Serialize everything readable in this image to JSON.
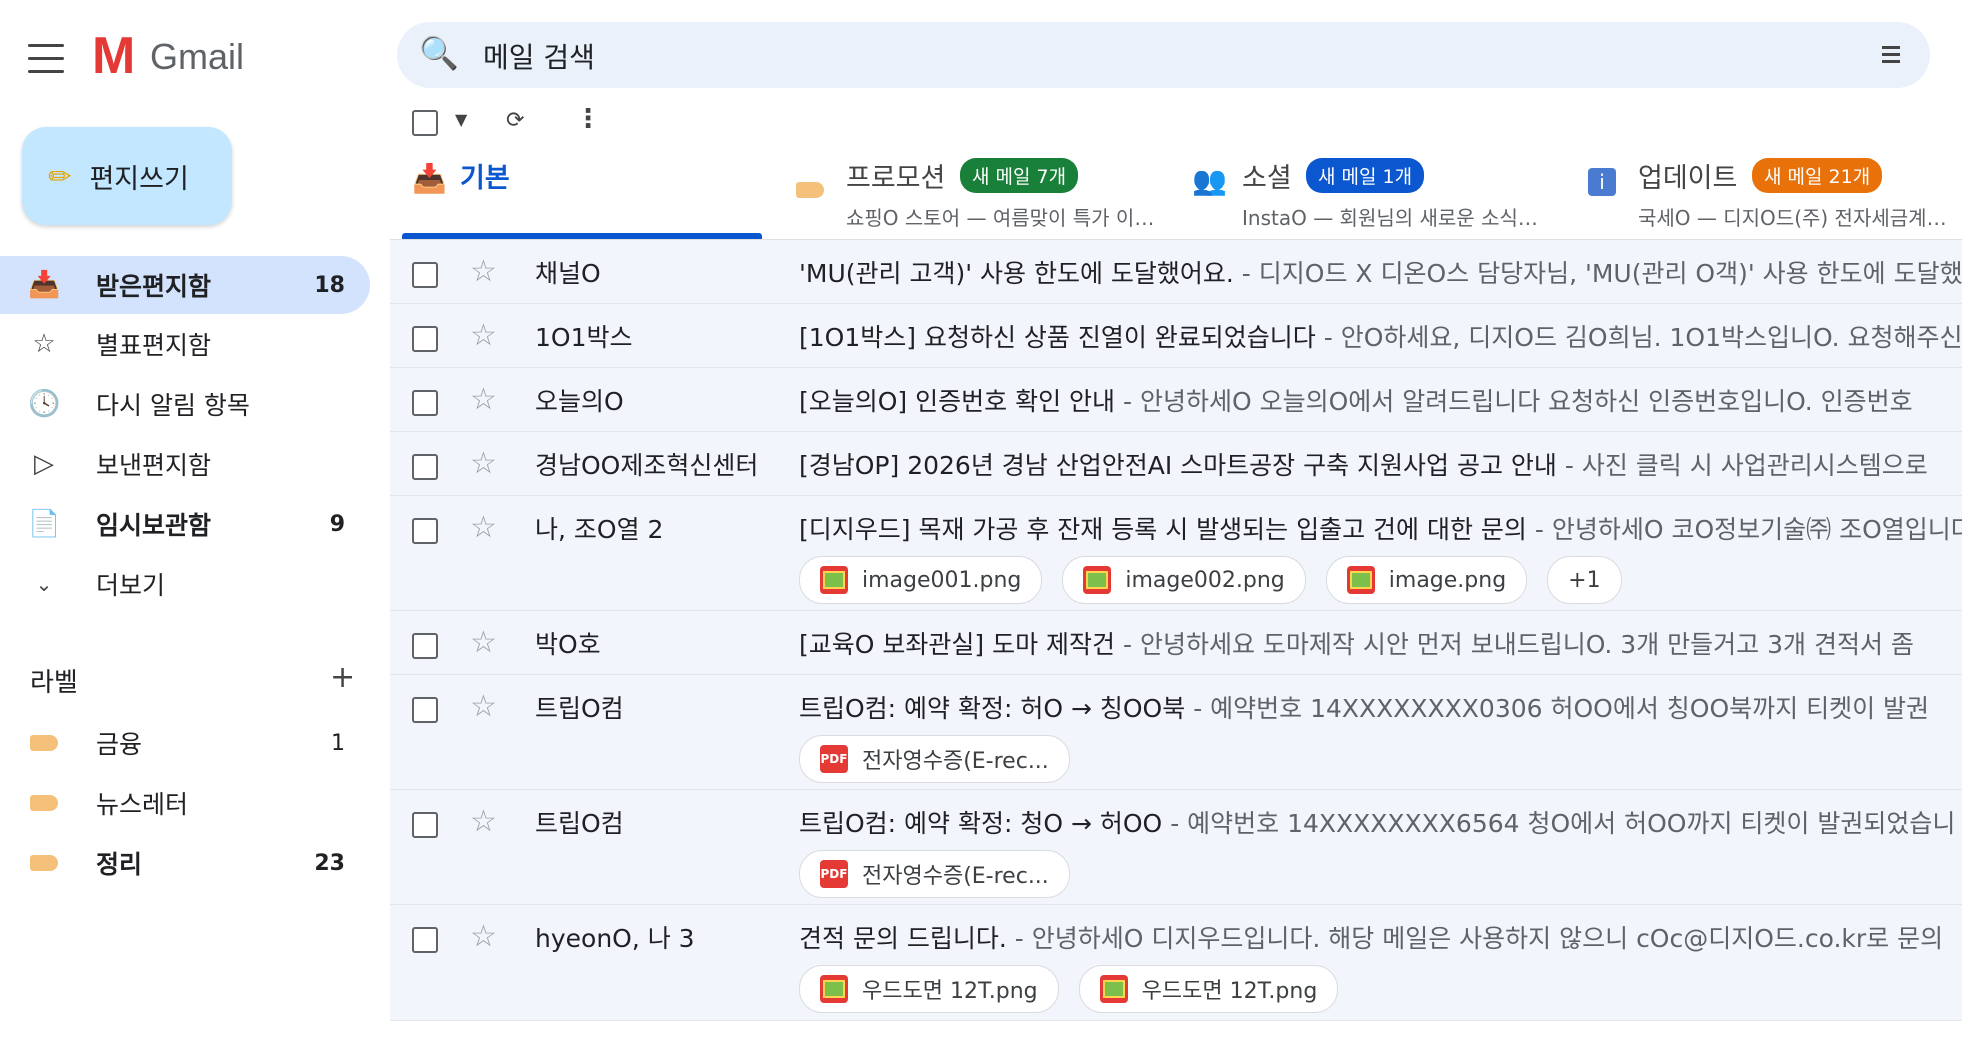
{
  "app": {
    "logo_letter": "M",
    "logo_text": "Gmail"
  },
  "compose": {
    "label": "편지쓰기"
  },
  "sidebar": {
    "items": [
      {
        "label": "받은편지함",
        "count": "18",
        "icon": "inbox-icon"
      },
      {
        "label": "별표편지함",
        "count": "",
        "icon": "star-icon"
      },
      {
        "label": "다시 알림 항목",
        "count": "",
        "icon": "clock-icon"
      },
      {
        "label": "보낸편지함",
        "count": "",
        "icon": "send-icon"
      },
      {
        "label": "임시보관함",
        "count": "9",
        "icon": "draft-icon"
      },
      {
        "label": "더보기",
        "count": "",
        "icon": "chevron-down-icon"
      }
    ],
    "labels_title": "라벨",
    "labels": [
      {
        "label": "금융",
        "count": "1"
      },
      {
        "label": "뉴스레터",
        "count": ""
      },
      {
        "label": "정리",
        "count": "23"
      }
    ]
  },
  "search": {
    "placeholder": "메일 검색"
  },
  "tabs": [
    {
      "name": "기본",
      "badge": "",
      "sub": ""
    },
    {
      "name": "프로모션",
      "badge": "새 메일 7개",
      "badge_color": "#188038",
      "sub": "쇼핑O 스토어 — 여름맞이 특가 이벤트"
    },
    {
      "name": "소셜",
      "badge": "새 메일 1개",
      "badge_color": "#0b57d0",
      "sub": "InstaO — 회원님의 새로운 소식이 있습니다"
    },
    {
      "name": "업데이트",
      "badge": "새 메일 21개",
      "badge_color": "#e8710a",
      "sub": "국세O — 디지O드(주) 전자세금계산서"
    }
  ],
  "emails": [
    {
      "sender": "채널O",
      "subject": "'MU(관리 고객)' 사용 한도에 도달했어요.",
      "snippet": " - 디지O드 X 디온O스 담당자님, 'MU(관리 O객)' 사용 한도에 도달했어요",
      "attachments": []
    },
    {
      "sender": "1O1박스",
      "subject": "[1O1박스] 요청하신 상품 진열이 완료되었습니다",
      "snippet": " - 안O하세요, 디지O드 김O희님. 1O1박스입니O. 요청해주신",
      "attachments": []
    },
    {
      "sender": "오늘의O",
      "subject": "[오늘의O] 인증번호 확인 안내",
      "snippet": " - 안녕하세O 오늘의O에서 알려드립니다 요청하신 인증번호입니O. 인증번호",
      "attachments": []
    },
    {
      "sender": "경남OO제조혁신센터",
      "subject": "[경남OP] 2026년 경남 산업안전AI 스마트공장 구축 지원사업 공고 안내",
      "snippet": " - 사진 클릭 시 사업관리시스템으로",
      "attachments": []
    },
    {
      "sender": "나, 조O열 2",
      "subject": "[디지우드] 목재 가공 후 잔재 등록 시 발생되는 입출고 건에 대한 문의",
      "snippet": " - 안녕하세O 코O정보기술㈜ 조O열입니다",
      "attachments": [
        {
          "name": "image001.png",
          "type": "img"
        },
        {
          "name": "image002.png",
          "type": "img"
        },
        {
          "name": "image.png",
          "type": "img"
        }
      ],
      "more": "+1"
    },
    {
      "sender": "박O호",
      "subject": "[교육O 보좌관실] 도마 제작건",
      "snippet": " - 안녕하세요 도마제작 시안 먼저 보내드립니O. 3개 만들거고 3개 견적서 좀",
      "attachments": []
    },
    {
      "sender": "트립O컴",
      "subject": "트립O컴: 예약 확정: 허O → 칭OO북",
      "snippet": " - 예약번호 14XXXXXXXX0306 허OO에서 칭OO북까지 티켓이 발권",
      "attachments": [
        {
          "name": "전자영수증(E-rec...",
          "type": "pdf"
        }
      ]
    },
    {
      "sender": "트립O컴",
      "subject": "트립O컴: 예약 확정: 청O → 허OO",
      "snippet": " - 예약번호 14XXXXXXXX6564 청O에서 허OO까지 티켓이 발권되었습니",
      "attachments": [
        {
          "name": "전자영수증(E-rec...",
          "type": "pdf"
        }
      ]
    },
    {
      "sender": "hyeonO, 나 3",
      "subject": "견적 문의 드립니다.",
      "snippet": " - 안녕하세O 디지우드입니다. 해당 메일은 사용하지 않으니 cOc@디지O드.co.kr로 문의",
      "attachments": [
        {
          "name": "우드도면 12T.png",
          "type": "img"
        },
        {
          "name": "우드도면 12T.png",
          "type": "img"
        }
      ]
    }
  ]
}
